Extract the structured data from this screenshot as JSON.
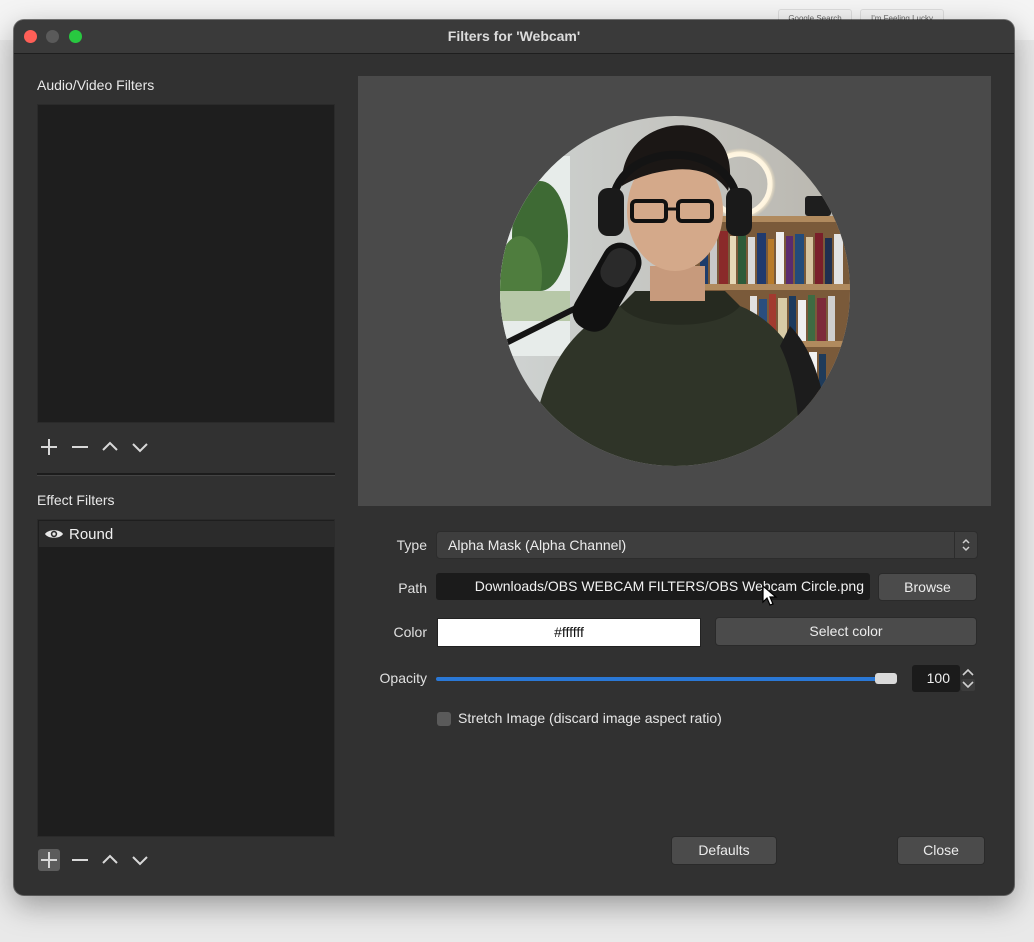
{
  "background": {
    "google_search": "Google Search",
    "feeling_lucky": "I'm Feeling Lucky"
  },
  "window": {
    "title": "Filters for 'Webcam'"
  },
  "left": {
    "av_filters_label": "Audio/Video Filters",
    "effect_filters_label": "Effect Filters",
    "effect_items": [
      {
        "label": "Round",
        "icon": "eye-icon"
      }
    ],
    "toolbar_icons": [
      "plus-icon",
      "minus-icon",
      "chevron-up-icon",
      "chevron-down-icon"
    ]
  },
  "form": {
    "type_label": "Type",
    "type_value": "Alpha Mask (Alpha Channel)",
    "path_label": "Path",
    "path_value": "Downloads/OBS WEBCAM FILTERS/OBS Webcam Circle.png",
    "browse_label": "Browse",
    "color_label": "Color",
    "color_value": "#ffffff",
    "select_color_label": "Select color",
    "opacity_label": "Opacity",
    "opacity_value": "100",
    "opacity_fraction": 1.0,
    "stretch_label": "Stretch Image (discard image aspect ratio)",
    "stretch_checked": false
  },
  "footer": {
    "defaults_label": "Defaults",
    "close_label": "Close"
  },
  "colors": {
    "accent": "#2a78d6",
    "window_bg": "#313131",
    "list_bg": "#1e1e1e",
    "preview_bg": "#4a4a4a"
  }
}
